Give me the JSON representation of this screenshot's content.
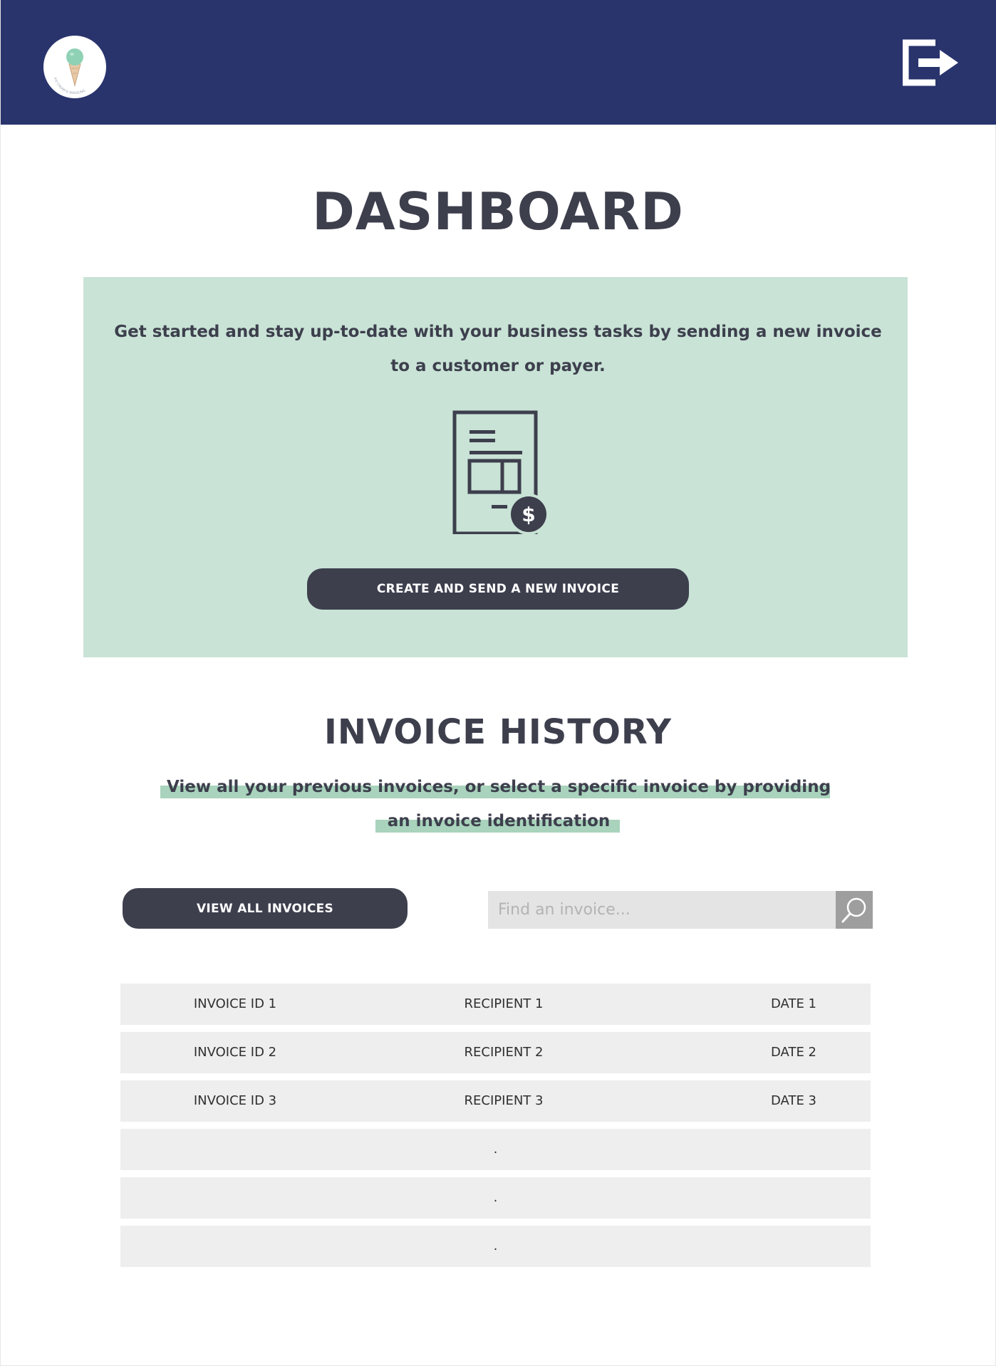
{
  "header": {
    "logo_alt": "ice cream logo",
    "logout_icon": "logout-icon"
  },
  "dashboard": {
    "title": "DASHBOARD",
    "promo_text": "Get started and stay up-to-date with your business tasks by sending a new invoice to a customer or payer.",
    "create_button": "CREATE AND SEND A NEW INVOICE",
    "illustration_icon": "invoice-dollar-icon"
  },
  "history": {
    "title": "INVOICE HISTORY",
    "subtitle_line1": "View all your previous invoices, or select a specific invoice by providing",
    "subtitle_line2": "an invoice identification",
    "view_all_button": "VIEW ALL INVOICES",
    "search_placeholder": "Find an invoice...",
    "search_icon": "search-icon",
    "rows": [
      {
        "id": "INVOICE ID 1",
        "recipient": "RECIPIENT 1",
        "date": "DATE 1"
      },
      {
        "id": "INVOICE ID 2",
        "recipient": "RECIPIENT 2",
        "date": "DATE 2"
      },
      {
        "id": "INVOICE ID 3",
        "recipient": "RECIPIENT 3",
        "date": "DATE 3"
      },
      {
        "placeholder": "."
      },
      {
        "placeholder": "."
      },
      {
        "placeholder": "."
      }
    ]
  },
  "colors": {
    "header_bg": "#29346d",
    "panel_bg": "#c9e3d6",
    "highlight": "#a9d3bc",
    "dark": "#3d3f4d",
    "row_bg": "#eeeeee"
  }
}
